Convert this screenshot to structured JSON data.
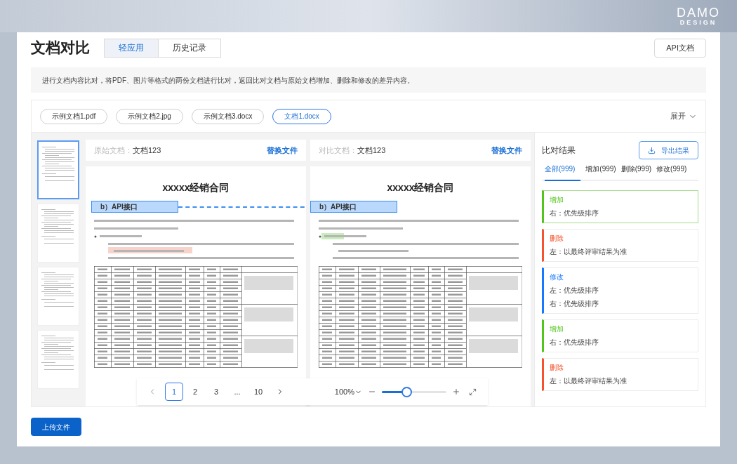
{
  "logo": {
    "mark": "DAMO",
    "sub": "DESIGN"
  },
  "header": {
    "title": "文档对比",
    "tabs": [
      {
        "label": "轻应用",
        "selected": true
      },
      {
        "label": "历史记录",
        "selected": false
      }
    ],
    "api_button": "API文档"
  },
  "description": "进行文档内容比对，将PDF、图片等格式的两份文档进行比对，返回比对文档与原始文档增加、删除和修改的差异内容。",
  "files": {
    "chips": [
      {
        "label": "示例文档1.pdf",
        "selected": false
      },
      {
        "label": "示例文档2.jpg",
        "selected": false
      },
      {
        "label": "示例文档3.docx",
        "selected": false
      },
      {
        "label": "文档1.docx",
        "selected": true
      }
    ],
    "expand": "展开"
  },
  "thumbnails": [
    {
      "selected": true
    },
    {
      "selected": false
    },
    {
      "selected": false
    },
    {
      "selected": false
    }
  ],
  "documents": [
    {
      "label": "原始文档：",
      "name": "文档123",
      "replace": "替换文件",
      "title": "xxxxx经销合同",
      "heading": "b）API接口",
      "kind": "delete"
    },
    {
      "label": "对比文档：",
      "name": "文档123",
      "replace": "替换文件",
      "title": "xxxxx经销合同",
      "heading": "b）API接口",
      "kind": "add"
    }
  ],
  "pagination": {
    "pages": [
      {
        "label": "1",
        "selected": true
      },
      {
        "label": "2",
        "selected": false
      },
      {
        "label": "3",
        "selected": false
      },
      {
        "label": "...",
        "selected": false
      },
      {
        "label": "10",
        "selected": false
      }
    ]
  },
  "zoom": {
    "value": "100%",
    "level": 0.38
  },
  "results": {
    "title": "比对结果",
    "export": "导出结果",
    "tabs": [
      {
        "label": "全部(999)",
        "selected": true
      },
      {
        "label": "增加(999)",
        "selected": false
      },
      {
        "label": "删除(999)",
        "selected": false
      },
      {
        "label": "修改(999)",
        "selected": false
      }
    ],
    "items": [
      {
        "kind": "add",
        "label": "增加",
        "selected": true,
        "lines": [
          "右：优先级排序"
        ]
      },
      {
        "kind": "delete",
        "label": "删除",
        "selected": false,
        "lines": [
          "左：以最终评审结果为准"
        ]
      },
      {
        "kind": "modify",
        "label": "修改",
        "selected": false,
        "lines": [
          "左：优先级排序",
          "右：优先级排序"
        ]
      },
      {
        "kind": "add",
        "label": "增加",
        "selected": false,
        "lines": [
          "右：优先级排序"
        ]
      },
      {
        "kind": "delete",
        "label": "删除",
        "selected": false,
        "lines": [
          "左：以最终评审结果为准"
        ]
      }
    ]
  },
  "upload": "上传文件"
}
